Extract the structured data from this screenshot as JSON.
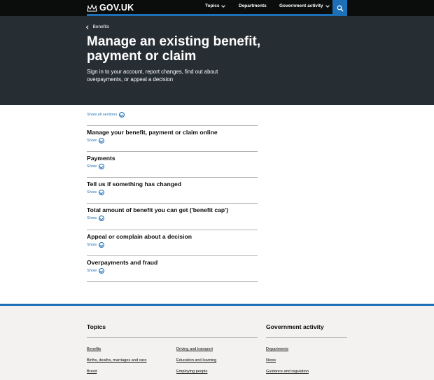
{
  "header": {
    "logo_text": "GOV.UK",
    "nav": {
      "topics": "Topics",
      "departments": "Departments",
      "government_activity": "Government activity"
    }
  },
  "hero": {
    "breadcrumb": "Benefits",
    "title": "Manage an existing benefit, payment or claim",
    "description": "Sign in to your account, report changes, find out about overpayments, or appeal a decision"
  },
  "accordion": {
    "show_all": "Show all sections",
    "sections": [
      {
        "title": "Manage your benefit, payment or claim online",
        "show": "Show"
      },
      {
        "title": "Payments",
        "show": "Show"
      },
      {
        "title": "Tell us if something has changed",
        "show": "Show"
      },
      {
        "title": "Total amount of benefit you can get ('benefit cap')",
        "show": "Show"
      },
      {
        "title": "Appeal or complain about a decision",
        "show": "Show"
      },
      {
        "title": "Overpayments and fraud",
        "show": "Show"
      }
    ]
  },
  "footer": {
    "topics_heading": "Topics",
    "gov_heading": "Government activity",
    "topics_col1": [
      "Benefits",
      "Births, deaths, marriages and care",
      "Brexit"
    ],
    "topics_col2": [
      "Driving and transport",
      "Education and learning",
      "Employing people"
    ],
    "gov_links": [
      "Departments",
      "News",
      "Guidance and regulation"
    ]
  },
  "colors": {
    "header_bg": "#0b0c0c",
    "hero_bg": "#262d33",
    "brand_blue": "#1d70b8",
    "footer_bg": "#f3f2f1"
  }
}
